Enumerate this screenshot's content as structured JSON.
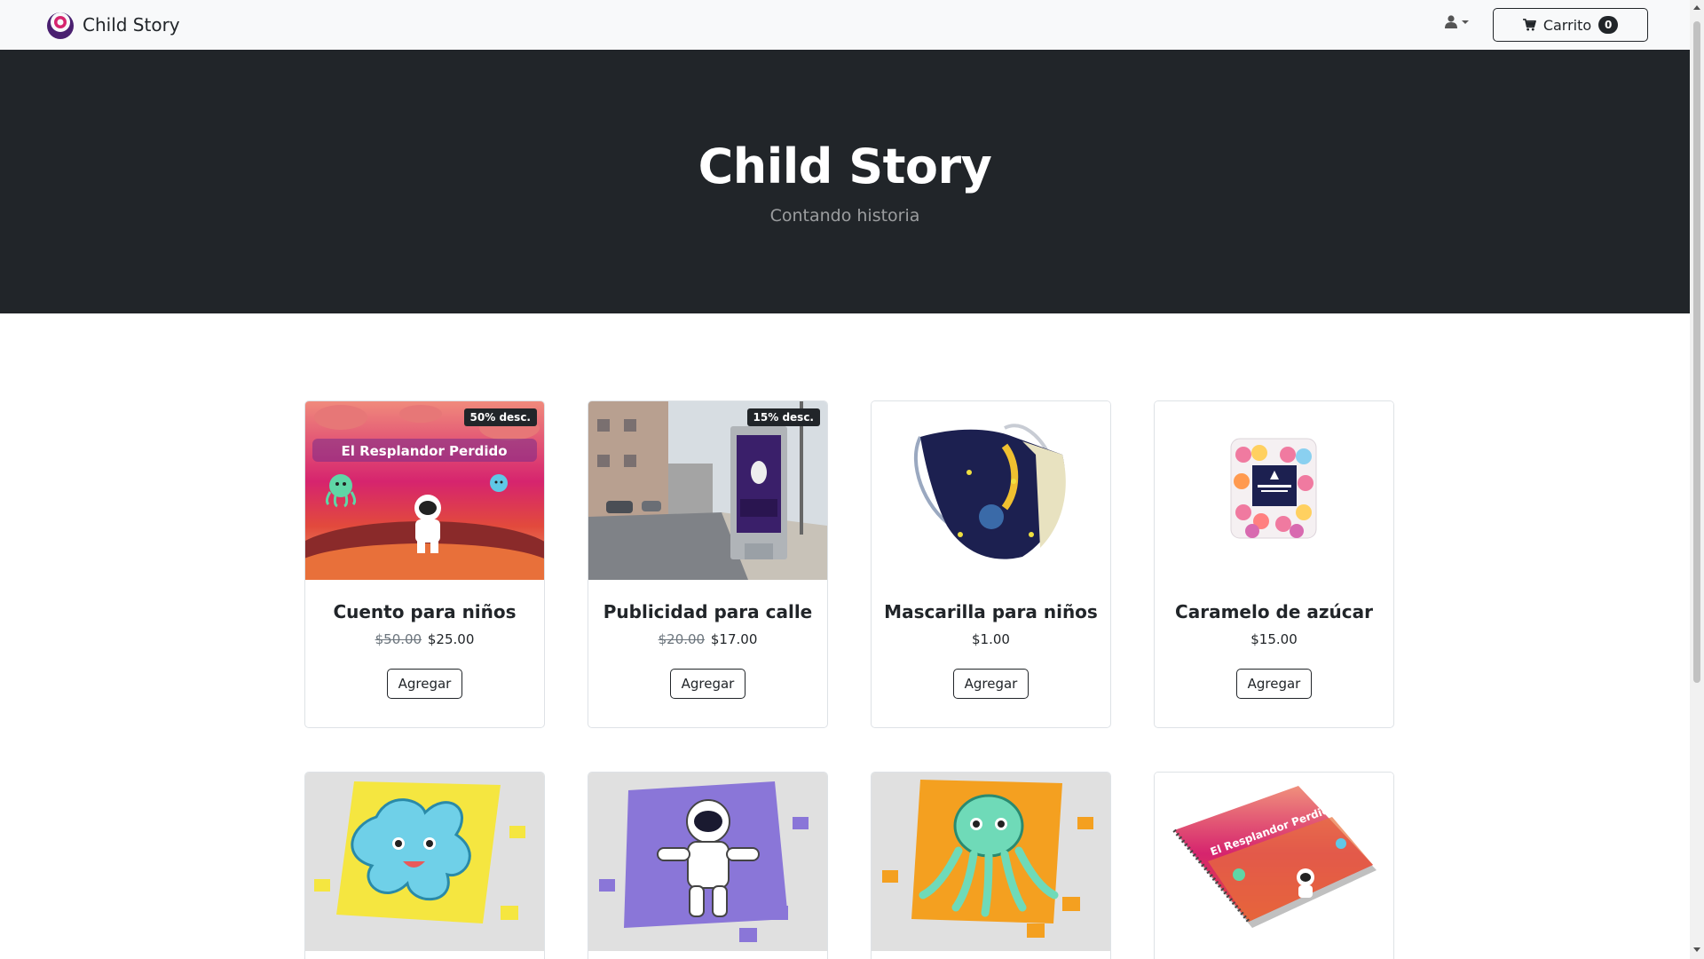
{
  "navbar": {
    "brand_name": "Child Story",
    "logo_icon": "child-story-logo",
    "user_icon": "user-icon",
    "cart_label": "Carrito",
    "cart_count": "0"
  },
  "hero": {
    "title": "Child Story",
    "subtitle": "Contando historia"
  },
  "products": [
    {
      "name": "Cuento para niños",
      "badge": "50% desc.",
      "old_price": "$50.00",
      "price": "$25.00",
      "button": "Agregar",
      "image": "book-cover-el-resplandor-perdido",
      "image_text": "El Resplandor Perdido"
    },
    {
      "name": "Publicidad para calle",
      "badge": "15% desc.",
      "old_price": "$20.00",
      "price": "$17.00",
      "button": "Agregar",
      "image": "street-billboard"
    },
    {
      "name": "Mascarilla para niños",
      "badge": "",
      "old_price": "",
      "price": "$1.00",
      "button": "Agregar",
      "image": "face-mask"
    },
    {
      "name": "Caramelo de azúcar",
      "badge": "",
      "old_price": "",
      "price": "$15.00",
      "button": "Agregar",
      "image": "candy-bag"
    },
    {
      "name": "",
      "image": "star-puzzle"
    },
    {
      "name": "",
      "image": "astronaut-puzzle"
    },
    {
      "name": "",
      "image": "octopus-puzzle"
    },
    {
      "name": "",
      "image": "notebook",
      "image_text": "El Resplandor Perdido"
    }
  ],
  "colors": {
    "dark": "#212529",
    "nav_bg": "#f8f9fa",
    "brand_purple": "#5b2a86",
    "brand_pink": "#d6246e"
  }
}
